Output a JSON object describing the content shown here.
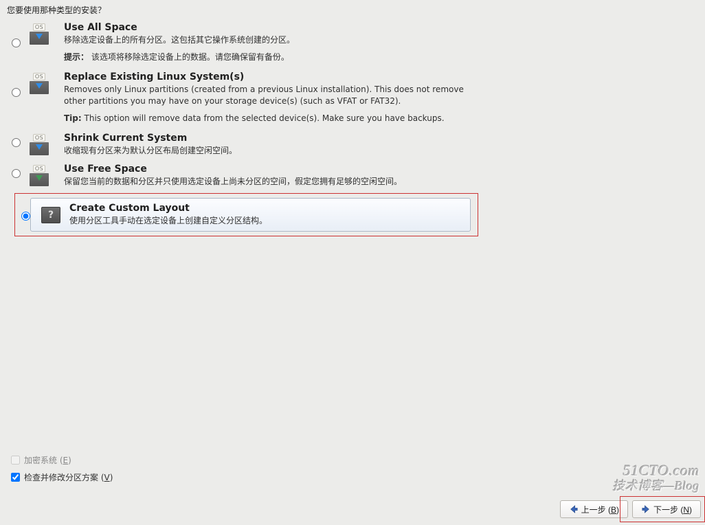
{
  "heading": "您要使用那种类型的安装？",
  "os_label": "OS",
  "options": [
    {
      "id": "use-all-space",
      "title": "Use All Space",
      "desc": "移除选定设备上的所有分区。这包括其它操作系统创建的分区。",
      "tip_label": "提示：",
      "tip": " 该选项将移除选定设备上的数据。请您确保留有备份。",
      "icon": "arrow-blue",
      "selected": false
    },
    {
      "id": "replace-linux",
      "title": "Replace Existing Linux System(s)",
      "desc": "Removes only Linux partitions (created from a previous Linux installation).  This does not remove other partitions you may have on your storage device(s) (such as VFAT or FAT32).",
      "tip_label": "Tip:",
      "tip": " This option will remove data from the selected device(s).  Make sure you have backups.",
      "icon": "arrow-blue",
      "selected": false
    },
    {
      "id": "shrink-current",
      "title": "Shrink Current System",
      "desc": "收缩现有分区来为默认分区布局创建空闲空间。",
      "tip_label": "",
      "tip": "",
      "icon": "arrow-blue",
      "selected": false
    },
    {
      "id": "use-free-space",
      "title": "Use Free Space",
      "desc": "保留您当前的数据和分区并只使用选定设备上尚未分区的空间，假定您拥有足够的空闲空间。",
      "tip_label": "",
      "tip": "",
      "icon": "arrow-green",
      "selected": false
    },
    {
      "id": "create-custom-layout",
      "title": "Create Custom Layout",
      "desc": "使用分区工具手动在选定设备上创建自定义分区结构。",
      "tip_label": "",
      "tip": "",
      "icon": "unknown",
      "selected": true
    }
  ],
  "checkboxes": {
    "encrypt": {
      "label_pre": "加密系统 (",
      "hotkey": "E",
      "label_post": ")",
      "checked": false,
      "enabled": false
    },
    "review": {
      "label_pre": "检查并修改分区方案 (",
      "hotkey": "V",
      "label_post": ")",
      "checked": true,
      "enabled": true
    }
  },
  "nav": {
    "back": {
      "label_pre": "上一步 (",
      "hotkey": "B",
      "label_post": ")"
    },
    "next": {
      "label_pre": "下一步 (",
      "hotkey": "N",
      "label_post": ")"
    }
  },
  "watermark": {
    "line1": "51CTO.com",
    "line2": "技术博客—Blog"
  }
}
